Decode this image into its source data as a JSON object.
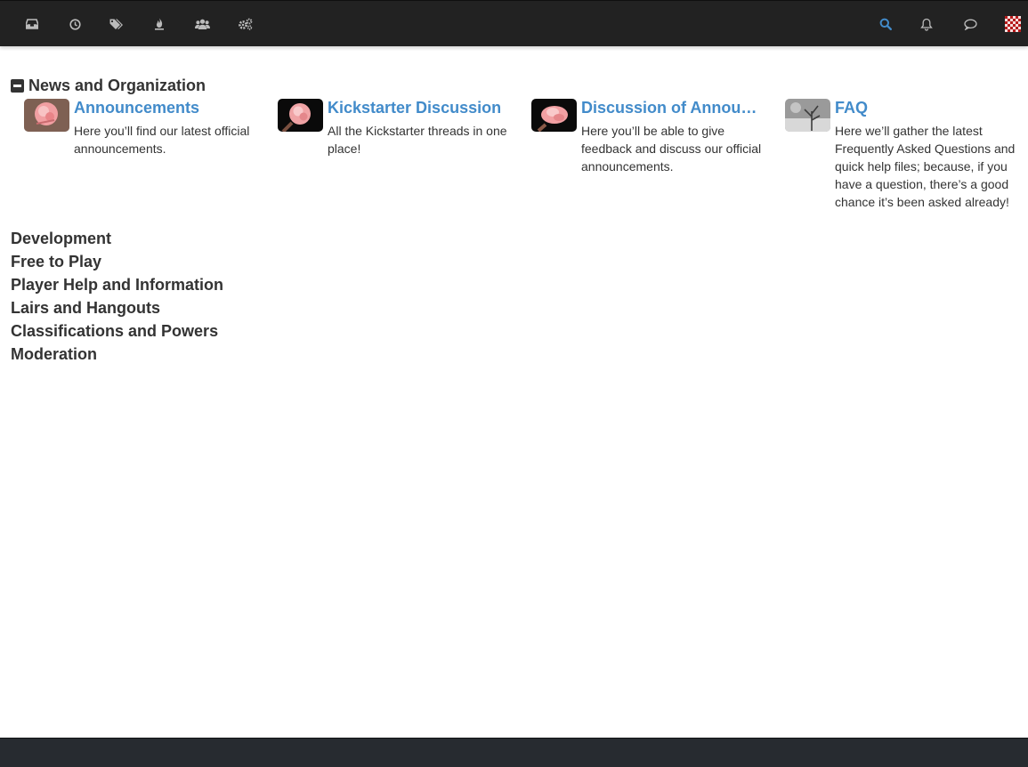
{
  "navbar": {
    "left_icons": [
      "inbox-icon",
      "clock-icon",
      "tags-icon",
      "fire-icon",
      "users-icon",
      "cogs-icon"
    ],
    "right_icons": [
      "search-icon",
      "bell-icon",
      "chat-icon"
    ],
    "accent_color": "#428bca"
  },
  "section": {
    "title": "News and Organization"
  },
  "forums": [
    {
      "title": "Announcements",
      "description": "Here you’ll find our latest official announcements."
    },
    {
      "title": "Kickstarter Discussion",
      "description": "All the Kickstarter threads in one place!"
    },
    {
      "title": "Discussion of Announcements",
      "description": "Here you’ll be able to give feedback and discuss our official announcements."
    },
    {
      "title": "FAQ",
      "description": "Here we’ll gather the latest Frequently Asked Questions and quick help files; because, if you have a question, there’s a good chance it’s been asked already!"
    }
  ],
  "categories": [
    "Development",
    "Free to Play",
    "Player Help and Information",
    "Lairs and Hangouts",
    "Classifications and Powers",
    "Moderation"
  ]
}
